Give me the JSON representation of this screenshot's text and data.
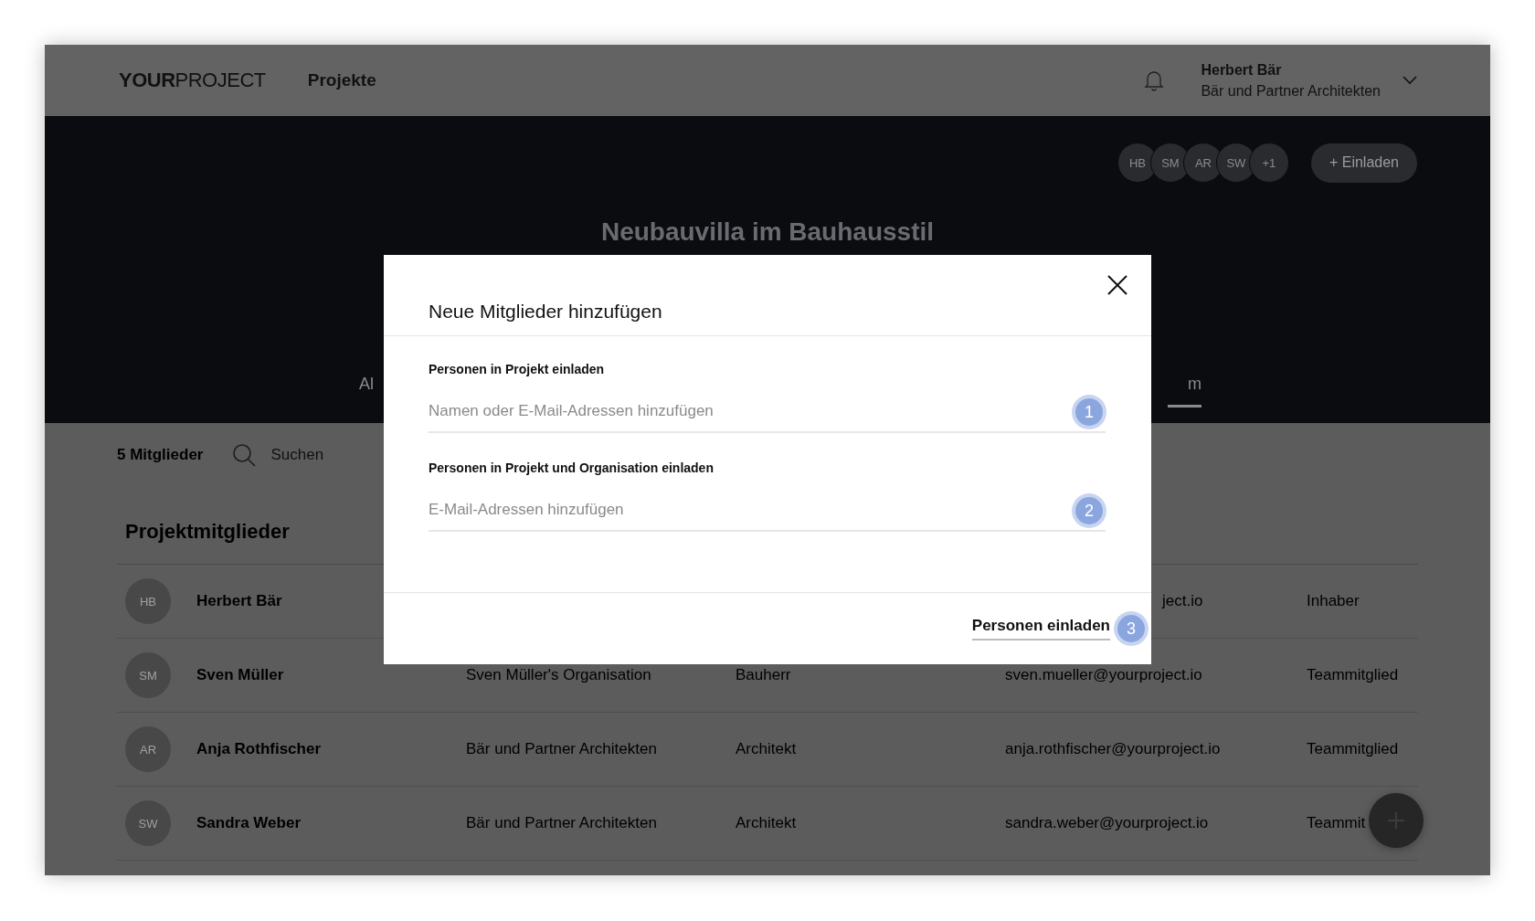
{
  "header": {
    "logo_bold": "YOUR",
    "logo_light": "PROJECT",
    "nav": "Projekte",
    "user_name": "Herbert Bär",
    "user_org": "Bär und Partner Architekten"
  },
  "hero": {
    "avatars": [
      "HB",
      "SM",
      "AR",
      "SW",
      "+1"
    ],
    "invite_button": "+ Einladen",
    "title": "Neubauvilla im Bauhausstil",
    "tabs": [
      {
        "label": "Al",
        "selected": false
      },
      {
        "label": "m",
        "selected": true
      }
    ]
  },
  "members_bar": {
    "count": "5 Mitglieder",
    "search_placeholder": "Suchen"
  },
  "section_title": "Projektmitglieder",
  "members": [
    {
      "initials": "HB",
      "name": "Herbert Bär",
      "email": "ject.io",
      "access": "Inhaber"
    },
    {
      "initials": "SM",
      "name": "Sven Müller",
      "organisation": "Sven Müller's Organisation",
      "role": "Bauherr",
      "email": "sven.mueller@yourproject.io",
      "access": "Teammitglied"
    },
    {
      "initials": "AR",
      "name": "Anja Rothfischer",
      "organisation": "Bär und Partner Architekten",
      "role": "Architekt",
      "email": "anja.rothfischer@yourproject.io",
      "access": "Teammitglied"
    },
    {
      "initials": "SW",
      "name": "Sandra Weber",
      "organisation": "Bär und Partner Architekten",
      "role": "Architekt",
      "email": "sandra.weber@yourproject.io",
      "access": "Teammit"
    }
  ],
  "dialog": {
    "title": "Neue Mitglieder hinzufügen",
    "fields": [
      {
        "label": "Personen in Projekt einladen",
        "placeholder": "Namen oder E-Mail-Adressen hinzufügen",
        "step": "1"
      },
      {
        "label": "Personen in Projekt und Organisation einladen",
        "placeholder": "E-Mail-Adressen hinzufügen",
        "step": "2"
      }
    ],
    "submit": "Personen einladen",
    "submit_step": "3"
  }
}
